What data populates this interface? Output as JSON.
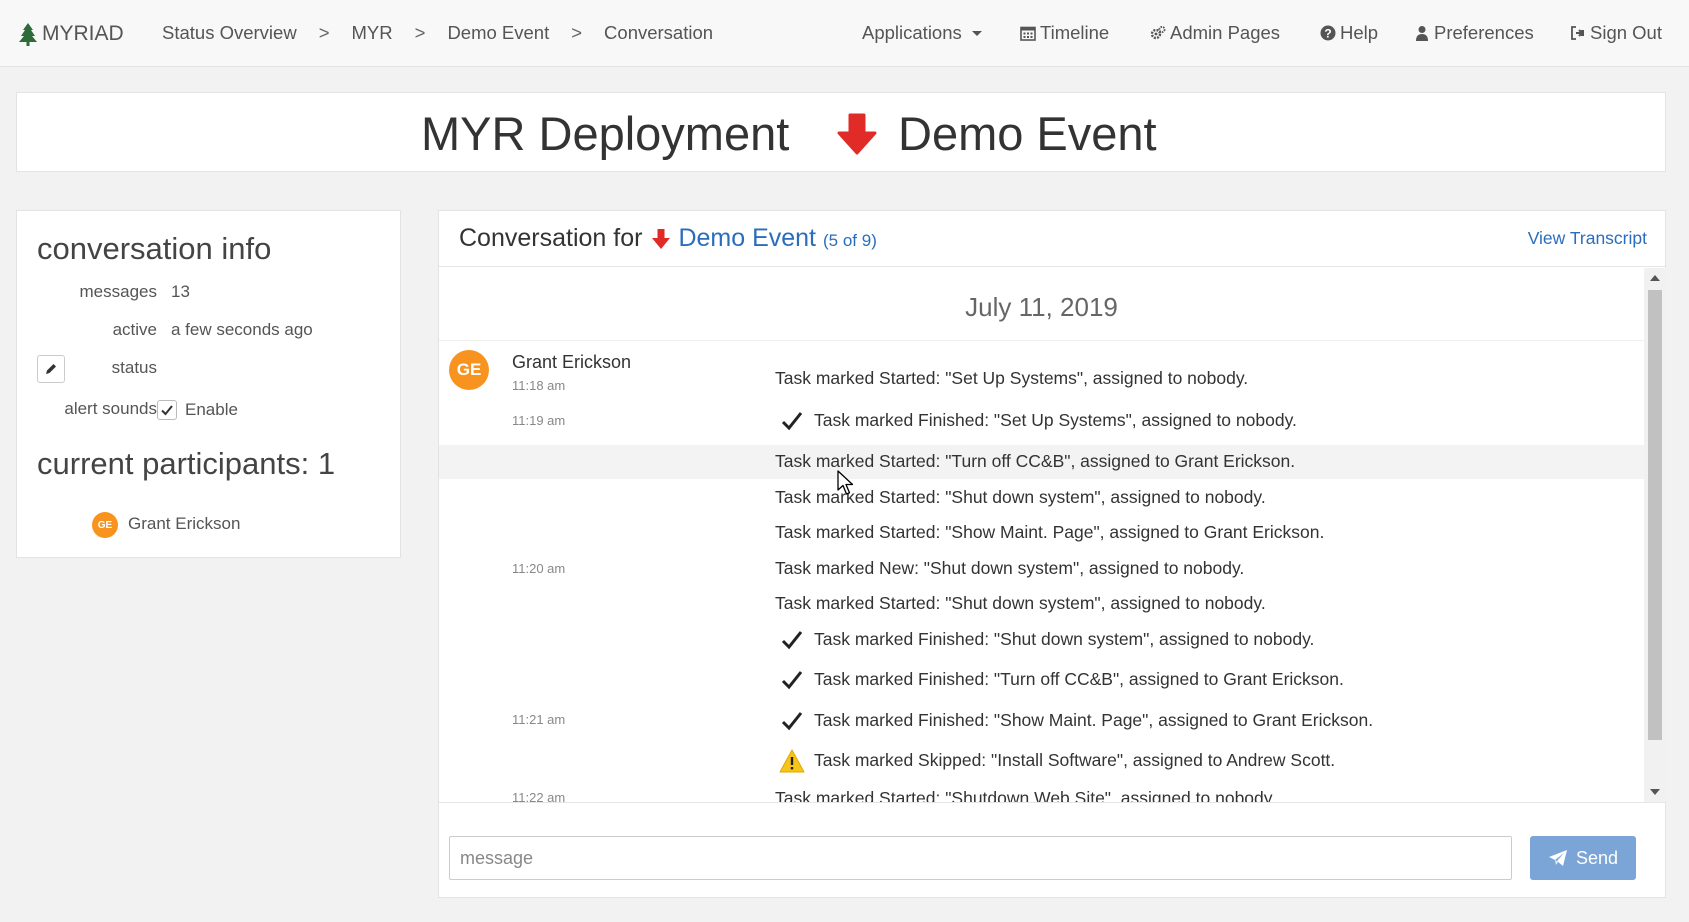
{
  "nav": {
    "brand": "MYRIAD",
    "breadcrumb": [
      "Status Overview",
      "MYR",
      "Demo Event",
      "Conversation"
    ],
    "breadcrumb_sep": ">",
    "applications": "Applications",
    "timeline": "Timeline",
    "admin": "Admin Pages",
    "help": "Help",
    "preferences": "Preferences",
    "signout": "Sign Out"
  },
  "title": {
    "left": "MYR Deployment",
    "right": "Demo Event",
    "arrow_color": "#e02b27"
  },
  "sidebar": {
    "info_title": "conversation info",
    "messages_label": "messages",
    "messages_value": "13",
    "active_label": "active",
    "active_value": "a few seconds ago",
    "status_label": "status",
    "alert_label": "alert sounds",
    "alert_enable": "Enable",
    "alert_checked": true,
    "participants_title": "current participants: 1",
    "participants": [
      {
        "initials": "GE",
        "name": "Grant Erickson"
      }
    ]
  },
  "conversation": {
    "title_prefix": "Conversation for",
    "event_link": "Demo Event",
    "count": "(5 of 9)",
    "view_transcript": "View Transcript",
    "date": "July 11, 2019",
    "author": {
      "initials": "GE",
      "name": "Grant Erickson",
      "color": "#f7931e"
    },
    "times": [
      "11:18 am",
      "11:19 am",
      "11:20 am",
      "11:21 am",
      "11:22 am"
    ],
    "messages": [
      {
        "icon": "",
        "text": "Task marked Started: \"Set Up Systems\", assigned to nobody."
      },
      {
        "icon": "check",
        "text": "Task marked Finished: \"Set Up Systems\", assigned to nobody."
      },
      {
        "icon": "",
        "text": "Task marked Started: \"Turn off CC&B\", assigned to Grant Erickson."
      },
      {
        "icon": "",
        "text": "Task marked Started: \"Shut down system\", assigned to nobody."
      },
      {
        "icon": "",
        "text": "Task marked Started: \"Show Maint. Page\", assigned to Grant Erickson."
      },
      {
        "icon": "",
        "text": "Task marked New: \"Shut down system\", assigned to nobody."
      },
      {
        "icon": "",
        "text": "Task marked Started: \"Shut down system\", assigned to nobody."
      },
      {
        "icon": "check",
        "text": "Task marked Finished: \"Shut down system\", assigned to nobody."
      },
      {
        "icon": "check",
        "text": "Task marked Finished: \"Turn off CC&B\", assigned to Grant Erickson."
      },
      {
        "icon": "check",
        "text": "Task marked Finished: \"Show Maint. Page\", assigned to Grant Erickson."
      },
      {
        "icon": "warning",
        "text": "Task marked Skipped: \"Install Software\", assigned to Andrew Scott."
      },
      {
        "icon": "",
        "text": "Task marked Started: \"Shutdown Web Site\", assigned to nobody."
      }
    ],
    "input_placeholder": "message",
    "send_label": "Send",
    "send_color": "#7aa5d6",
    "link_color": "#2a6ebb"
  }
}
